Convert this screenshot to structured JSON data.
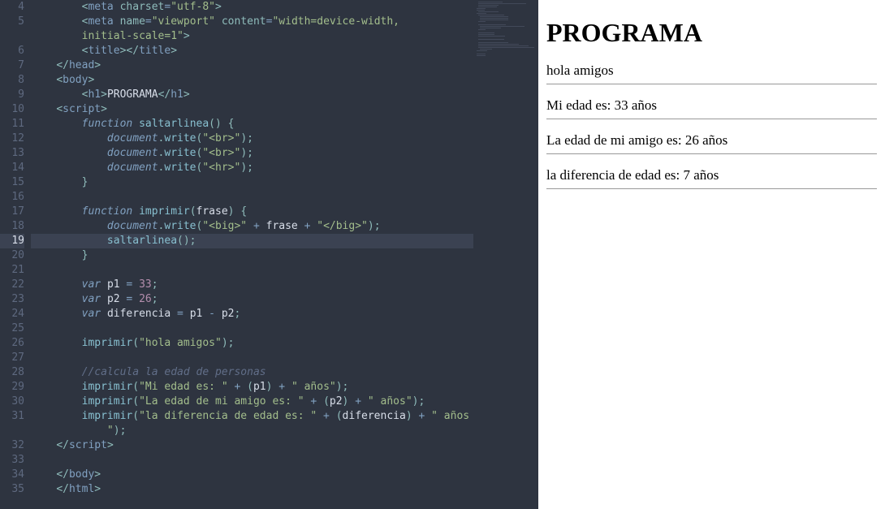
{
  "editor": {
    "first_line_no": 4,
    "active_line_index": 16,
    "lines": [
      {
        "indent": 2,
        "tokens": [
          [
            "p",
            "<"
          ],
          [
            "t",
            "meta "
          ],
          [
            "a",
            "charset"
          ],
          [
            "op",
            "="
          ],
          [
            "s",
            "\"utf-8\""
          ],
          [
            "p",
            ">"
          ]
        ]
      },
      {
        "indent": 2,
        "tokens": [
          [
            "p",
            "<"
          ],
          [
            "t",
            "meta "
          ],
          [
            "a",
            "name"
          ],
          [
            "op",
            "="
          ],
          [
            "s",
            "\"viewport\""
          ],
          [
            "id",
            " "
          ],
          [
            "a",
            "content"
          ],
          [
            "op",
            "="
          ],
          [
            "s",
            "\"width=device-width, "
          ]
        ]
      },
      {
        "indent": 2,
        "tokens": [
          [
            "s",
            "initial-scale=1\""
          ],
          [
            "p",
            ">"
          ]
        ]
      },
      {
        "indent": 2,
        "tokens": [
          [
            "p",
            "<"
          ],
          [
            "t",
            "title"
          ],
          [
            "p",
            "></"
          ],
          [
            "t",
            "title"
          ],
          [
            "p",
            ">"
          ]
        ]
      },
      {
        "indent": 1,
        "tokens": [
          [
            "p",
            "</"
          ],
          [
            "t",
            "head"
          ],
          [
            "p",
            ">"
          ]
        ]
      },
      {
        "indent": 1,
        "tokens": [
          [
            "p",
            "<"
          ],
          [
            "t",
            "body"
          ],
          [
            "p",
            ">"
          ]
        ]
      },
      {
        "indent": 2,
        "tokens": [
          [
            "p",
            "<"
          ],
          [
            "t",
            "h1"
          ],
          [
            "p",
            ">"
          ],
          [
            "id",
            "PROGRAMA"
          ],
          [
            "p",
            "</"
          ],
          [
            "t",
            "h1"
          ],
          [
            "p",
            ">"
          ]
        ]
      },
      {
        "indent": 1,
        "tokens": [
          [
            "p",
            "<"
          ],
          [
            "t",
            "script"
          ],
          [
            "p",
            ">"
          ]
        ]
      },
      {
        "indent": 2,
        "tokens": [
          [
            "k",
            "function "
          ],
          [
            "fn",
            "saltarlinea"
          ],
          [
            "p",
            "() {"
          ]
        ]
      },
      {
        "indent": 3,
        "tokens": [
          [
            "k",
            "document"
          ],
          [
            "p",
            "."
          ],
          [
            "fn",
            "write"
          ],
          [
            "p",
            "("
          ],
          [
            "s",
            "\"<br>\""
          ],
          [
            "p",
            ");"
          ]
        ]
      },
      {
        "indent": 3,
        "tokens": [
          [
            "k",
            "document"
          ],
          [
            "p",
            "."
          ],
          [
            "fn",
            "write"
          ],
          [
            "p",
            "("
          ],
          [
            "s",
            "\"<br>\""
          ],
          [
            "p",
            ");"
          ]
        ]
      },
      {
        "indent": 3,
        "tokens": [
          [
            "k",
            "document"
          ],
          [
            "p",
            "."
          ],
          [
            "fn",
            "write"
          ],
          [
            "p",
            "("
          ],
          [
            "s",
            "\"<hr>\""
          ],
          [
            "p",
            ");"
          ]
        ]
      },
      {
        "indent": 2,
        "tokens": [
          [
            "p",
            "}"
          ]
        ]
      },
      {
        "indent": 0,
        "tokens": []
      },
      {
        "indent": 2,
        "tokens": [
          [
            "k",
            "function "
          ],
          [
            "fn",
            "imprimir"
          ],
          [
            "p",
            "("
          ],
          [
            "id",
            "frase"
          ],
          [
            "p",
            ") {"
          ]
        ]
      },
      {
        "indent": 3,
        "tokens": [
          [
            "k",
            "document"
          ],
          [
            "p",
            "."
          ],
          [
            "fn",
            "write"
          ],
          [
            "p",
            "("
          ],
          [
            "s",
            "\"<big>\""
          ],
          [
            "op",
            " + "
          ],
          [
            "id",
            "frase"
          ],
          [
            "op",
            " + "
          ],
          [
            "s",
            "\"</big>\""
          ],
          [
            "p",
            ");"
          ]
        ]
      },
      {
        "indent": 3,
        "tokens": [
          [
            "fn",
            "saltarlinea"
          ],
          [
            "p",
            "();"
          ]
        ]
      },
      {
        "indent": 2,
        "tokens": [
          [
            "p",
            "}"
          ]
        ]
      },
      {
        "indent": 0,
        "tokens": []
      },
      {
        "indent": 2,
        "tokens": [
          [
            "k",
            "var "
          ],
          [
            "id",
            "p1"
          ],
          [
            "op",
            " = "
          ],
          [
            "n",
            "33"
          ],
          [
            "p",
            ";"
          ]
        ]
      },
      {
        "indent": 2,
        "tokens": [
          [
            "k",
            "var "
          ],
          [
            "id",
            "p2"
          ],
          [
            "op",
            " = "
          ],
          [
            "n",
            "26"
          ],
          [
            "p",
            ";"
          ]
        ]
      },
      {
        "indent": 2,
        "tokens": [
          [
            "k",
            "var "
          ],
          [
            "id",
            "diferencia"
          ],
          [
            "op",
            " = "
          ],
          [
            "id",
            "p1"
          ],
          [
            "op",
            " - "
          ],
          [
            "id",
            "p2"
          ],
          [
            "p",
            ";"
          ]
        ]
      },
      {
        "indent": 0,
        "tokens": []
      },
      {
        "indent": 2,
        "tokens": [
          [
            "fn",
            "imprimir"
          ],
          [
            "p",
            "("
          ],
          [
            "s",
            "\"hola amigos\""
          ],
          [
            "p",
            ");"
          ]
        ]
      },
      {
        "indent": 0,
        "tokens": []
      },
      {
        "indent": 2,
        "tokens": [
          [
            "c",
            "//calcula la edad de personas"
          ]
        ]
      },
      {
        "indent": 2,
        "tokens": [
          [
            "fn",
            "imprimir"
          ],
          [
            "p",
            "("
          ],
          [
            "s",
            "\"Mi edad es: \""
          ],
          [
            "op",
            " + "
          ],
          [
            "p",
            "("
          ],
          [
            "id",
            "p1"
          ],
          [
            "p",
            ")"
          ],
          [
            "op",
            " + "
          ],
          [
            "s",
            "\" años\""
          ],
          [
            "p",
            ");"
          ]
        ]
      },
      {
        "indent": 2,
        "tokens": [
          [
            "fn",
            "imprimir"
          ],
          [
            "p",
            "("
          ],
          [
            "s",
            "\"La edad de mi amigo es: \""
          ],
          [
            "op",
            " + "
          ],
          [
            "p",
            "("
          ],
          [
            "id",
            "p2"
          ],
          [
            "p",
            ")"
          ],
          [
            "op",
            " + "
          ],
          [
            "s",
            "\" años\""
          ],
          [
            "p",
            ");"
          ]
        ]
      },
      {
        "indent": 2,
        "tokens": [
          [
            "fn",
            "imprimir"
          ],
          [
            "p",
            "("
          ],
          [
            "s",
            "\"la diferencia de edad es: \""
          ],
          [
            "op",
            " + "
          ],
          [
            "p",
            "("
          ],
          [
            "id",
            "diferencia"
          ],
          [
            "p",
            ")"
          ],
          [
            "op",
            " + "
          ],
          [
            "s",
            "\" años"
          ]
        ]
      },
      {
        "indent": 3,
        "tokens": [
          [
            "s",
            "\""
          ],
          [
            "p",
            ");"
          ]
        ]
      },
      {
        "indent": 1,
        "tokens": [
          [
            "p",
            "</"
          ],
          [
            "t",
            "script"
          ],
          [
            "p",
            ">"
          ]
        ]
      },
      {
        "indent": 0,
        "tokens": []
      },
      {
        "indent": 1,
        "tokens": [
          [
            "p",
            "</"
          ],
          [
            "t",
            "body"
          ],
          [
            "p",
            ">"
          ]
        ]
      },
      {
        "indent": 1,
        "tokens": [
          [
            "p",
            "</"
          ],
          [
            "t",
            "html"
          ],
          [
            "p",
            ">"
          ]
        ]
      }
    ]
  },
  "preview": {
    "heading": "PROGRAMA",
    "lines": [
      "hola amigos",
      "Mi edad es: 33 años",
      "La edad de mi amigo es: 26 años",
      "la diferencia de edad es: 7 años"
    ]
  }
}
